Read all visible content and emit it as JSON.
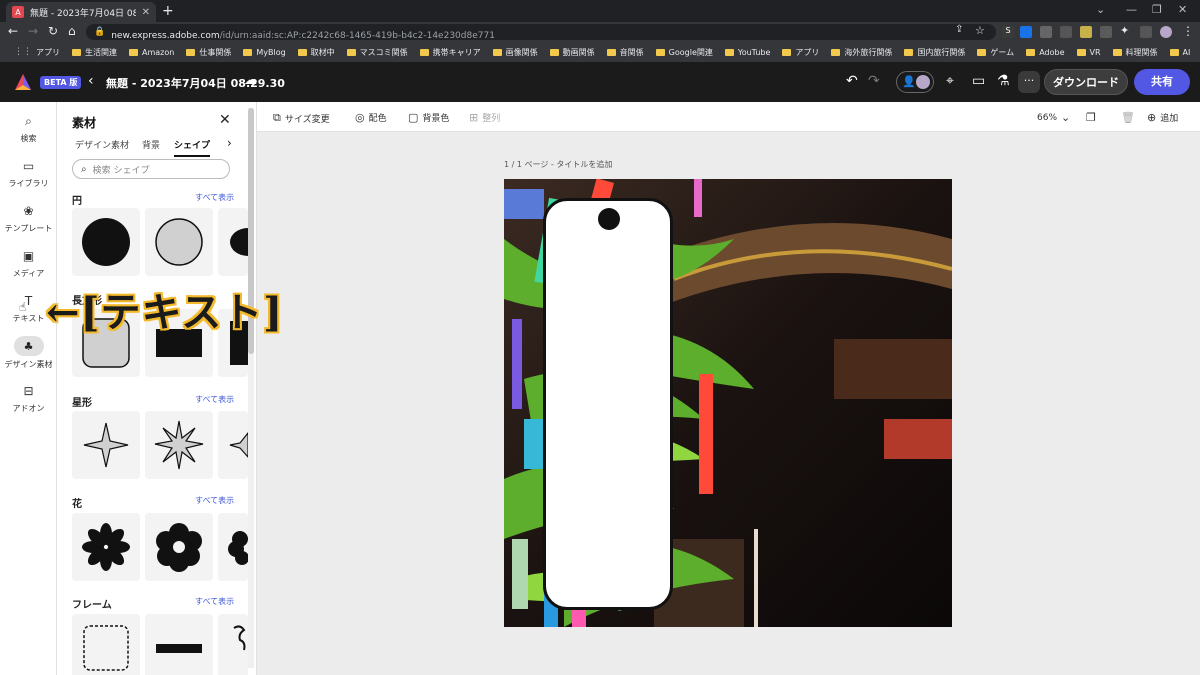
{
  "browser": {
    "tab_title": "無題 - 2023年7月04日 08.29.30",
    "url_domain": "new.express.adobe.com",
    "url_path": "/id/urn:aaid:sc:AP:c2242c68-1465-419b-b4c2-14e230d8e771",
    "bookmarks": [
      "アプリ",
      "生活関連",
      "Amazon",
      "仕事関係",
      "MyBlog",
      "取材中",
      "マスコミ関係",
      "携帯キャリア",
      "画像関係",
      "動画関係",
      "音関係",
      "Google関連",
      "YouTube",
      "アプリ",
      "海外旅行関係",
      "国内旅行関係",
      "ゲーム",
      "Adobe",
      "VR",
      "料理関係",
      "AI"
    ]
  },
  "app": {
    "badge": "BETA 版",
    "doc_title": "無題 - 2023年7月04日 08.29.30",
    "download_label": "ダウンロード",
    "share_label": "共有",
    "more_label": "···"
  },
  "rail": {
    "items": [
      {
        "label": "検索",
        "icon": "search-icon"
      },
      {
        "label": "ライブラリ",
        "icon": "folder-icon"
      },
      {
        "label": "テンプレート",
        "icon": "template-icon"
      },
      {
        "label": "メディア",
        "icon": "media-icon"
      },
      {
        "label": "テキスト",
        "icon": "text-icon"
      },
      {
        "label": "デザイン素材",
        "icon": "design-asset-icon"
      },
      {
        "label": "アドオン",
        "icon": "addon-icon"
      }
    ]
  },
  "panel": {
    "title": "素材",
    "tabs": [
      "デザイン素材",
      "背景",
      "シェイプ"
    ],
    "active_tab": "シェイプ",
    "search_placeholder": "検索 シェイプ",
    "see_all": "すべて表示",
    "sections": [
      "円",
      "長方形",
      "星形",
      "花",
      "フレーム"
    ]
  },
  "toolbar": {
    "resize": "サイズ変更",
    "color": "配色",
    "background": "背景色",
    "arrange": "整列",
    "zoom": "66%",
    "add": "追加"
  },
  "canvas": {
    "page_label": "1 / 1 ページ - タイトルを追加"
  },
  "caption": "←[テキスト]"
}
